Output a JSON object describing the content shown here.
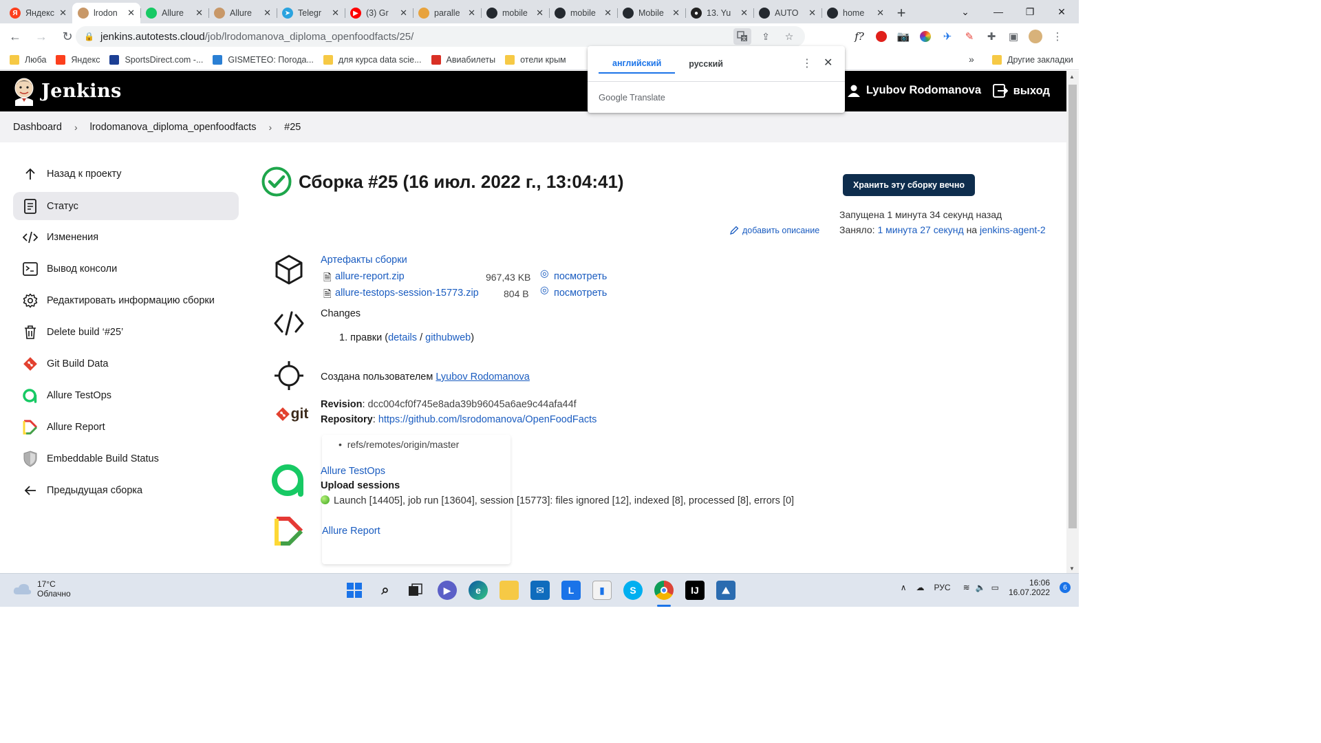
{
  "browser": {
    "tabs": [
      {
        "title": "Яндекс",
        "color": "#fc3f1d",
        "glyph": "Я"
      },
      {
        "title": "lrodon",
        "color": "#c89868",
        "glyph": "",
        "active": true
      },
      {
        "title": "Allure",
        "color": "#17c964",
        "glyph": ""
      },
      {
        "title": "Allure",
        "color": "#c89868",
        "glyph": ""
      },
      {
        "title": "Telegr",
        "color": "#2aa3df",
        "glyph": "➤"
      },
      {
        "title": "(3) Gr",
        "color": "#ff0000",
        "glyph": "▶"
      },
      {
        "title": "paralle",
        "color": "#e8a33d",
        "glyph": ""
      },
      {
        "title": "mobile",
        "color": "#24292f",
        "glyph": ""
      },
      {
        "title": "mobile",
        "color": "#24292f",
        "glyph": ""
      },
      {
        "title": "Mobile",
        "color": "#24292f",
        "glyph": ""
      },
      {
        "title": "13. Yu",
        "color": "#222222",
        "glyph": "●"
      },
      {
        "title": "AUTO",
        "color": "#24292f",
        "glyph": ""
      },
      {
        "title": "home",
        "color": "#24292f",
        "glyph": ""
      }
    ],
    "url_host": "jenkins.autotests.cloud",
    "url_path": "/job/lrodomanova_diploma_openfoodfacts/25/",
    "bookmarks": [
      {
        "label": "Люба",
        "kind": "folder"
      },
      {
        "label": "Яндекс",
        "kind": "yandex"
      },
      {
        "label": "SportsDirect.com -...",
        "kind": "flag"
      },
      {
        "label": "GISMETEO: Погода...",
        "kind": "gismeteo"
      },
      {
        "label": "для курса data scie...",
        "kind": "folder"
      },
      {
        "label": "Авиабилеты",
        "kind": "avia"
      },
      {
        "label": "отели крым",
        "kind": "folder"
      }
    ],
    "bookmarks_overflow": "»",
    "other_bookmarks": "Другие закладки",
    "translate_popup": {
      "tab_english": "английский",
      "tab_russian": "русский",
      "brand_google": "Google",
      "brand_translate": "Translate"
    }
  },
  "jenkins": {
    "title": "Jenkins",
    "user": "Lyubov Rodomanova",
    "logout": "выход",
    "breadcrumbs": [
      "Dashboard",
      "lrodomanova_diploma_openfoodfacts",
      "#25"
    ],
    "sidebar": [
      {
        "label": "Назад к проекту",
        "icon": "arrow-up-icon"
      },
      {
        "label": "Статус",
        "icon": "document-icon",
        "active": true
      },
      {
        "label": "Изменения",
        "icon": "code-icon"
      },
      {
        "label": "Вывод консоли",
        "icon": "terminal-icon"
      },
      {
        "label": "Редактировать информацию сборки",
        "icon": "gear-icon"
      },
      {
        "label": "Delete build ‘#25’",
        "icon": "trash-icon"
      },
      {
        "label": "Git Build Data",
        "icon": "git-icon"
      },
      {
        "label": "Allure TestOps",
        "icon": "allure-testops-icon"
      },
      {
        "label": "Allure Report",
        "icon": "allure-report-icon"
      },
      {
        "label": "Embeddable Build Status",
        "icon": "shield-icon"
      },
      {
        "label": "Предыдущая сборка",
        "icon": "arrow-left-icon"
      }
    ],
    "build": {
      "heading": "Сборка #25 (16 июл. 2022 г., 13:04:41)",
      "keep_button": "Хранить эту сборку вечно",
      "started": "Запущена 1 минута 34 секунд назад",
      "took_prefix": "Заняло:",
      "took_duration": "1 минута 27 секунд",
      "took_on": "на",
      "took_agent": "jenkins-agent-2",
      "add_description": "добавить описание",
      "artifacts_title": "Артефакты сборки",
      "artifacts": [
        {
          "name": "allure-report.zip",
          "size": "967,43 KB",
          "view": "посмотреть"
        },
        {
          "name": "allure-testops-session-15773.zip",
          "size": "804 B",
          "view": "посмотреть"
        }
      ],
      "changes_title": "Changes",
      "change_item_num": "1.",
      "change_item_text": "правки (",
      "change_details": "details",
      "change_slash": "/",
      "change_githubweb": "githubweb",
      "change_close": ")",
      "created_by_prefix": "Создана пользователем",
      "created_by_user": "Lyubov Rodomanova",
      "revision_label": "Revision",
      "revision_value": "dcc004cf0f745e8ada39b96045a6ae9c44afa44f",
      "repository_label": "Repository",
      "repository_value": "https://github.com/lsrodomanova/OpenFoodFacts",
      "ref": "refs/remotes/origin/master",
      "testops_title": "Allure TestOps",
      "upload_sessions": "Upload sessions",
      "session_line": "Launch [14405], job run [13604], session [15773]: files ignored [12], indexed [8], processed [8], errors [0]",
      "allure_report": "Allure Report",
      "git_logo_text": "git"
    }
  },
  "taskbar": {
    "temperature": "17°C",
    "weather": "Облачно",
    "lang": "РУС",
    "time": "16:06",
    "date": "16.07.2022",
    "notifications": "6"
  }
}
